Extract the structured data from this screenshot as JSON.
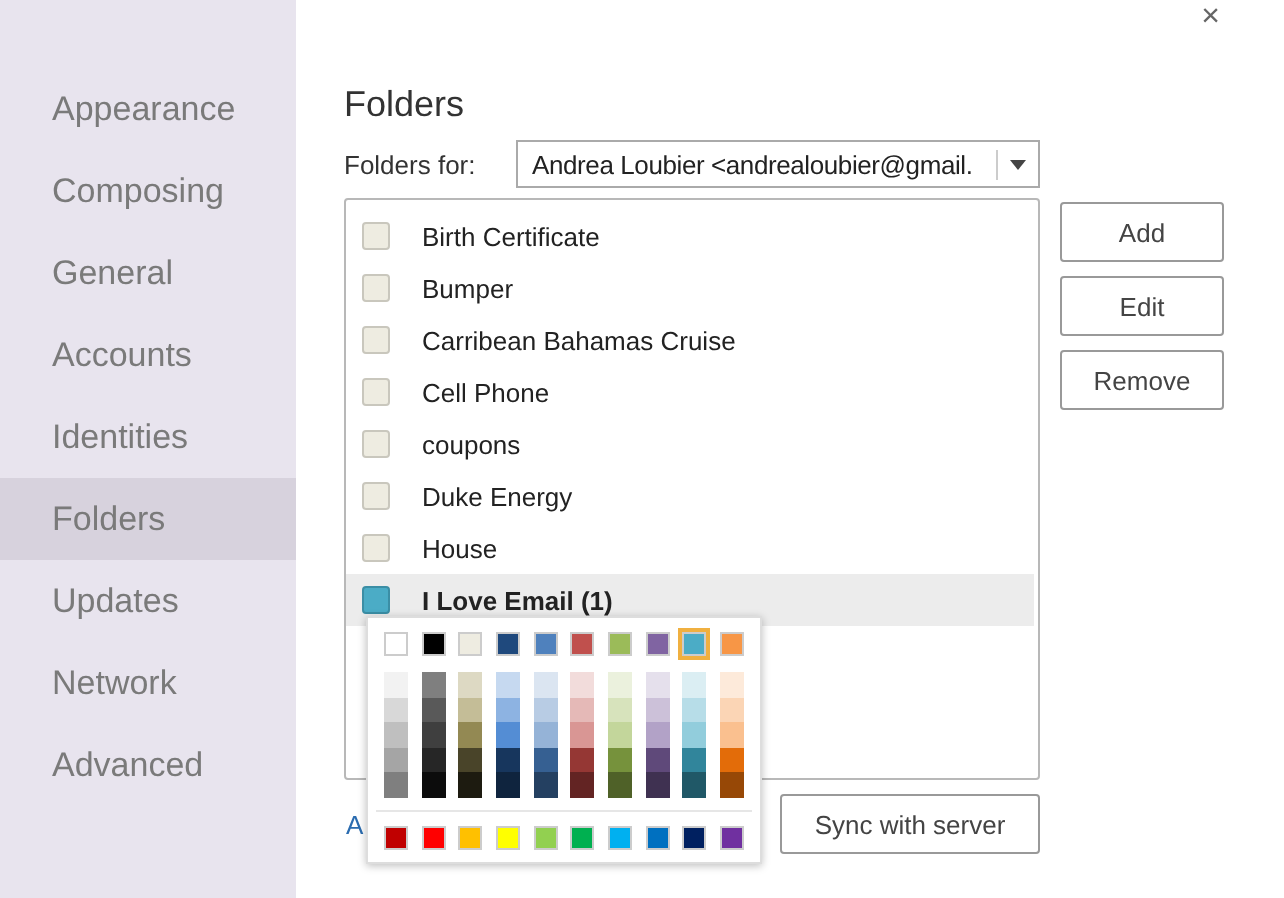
{
  "close": "×",
  "sidebar": {
    "items": [
      {
        "label": "Appearance",
        "selected": false
      },
      {
        "label": "Composing",
        "selected": false
      },
      {
        "label": "General",
        "selected": false
      },
      {
        "label": "Accounts",
        "selected": false
      },
      {
        "label": "Identities",
        "selected": false
      },
      {
        "label": "Folders",
        "selected": true
      },
      {
        "label": "Updates",
        "selected": false
      },
      {
        "label": "Network",
        "selected": false
      },
      {
        "label": "Advanced",
        "selected": false
      }
    ]
  },
  "title": "Folders",
  "folders_for": {
    "label": "Folders for:",
    "value": "Andrea Loubier  <andrealoubier@gmail."
  },
  "folders": [
    {
      "label": "Birth Certificate",
      "color": "#eeece1",
      "selected": false
    },
    {
      "label": "Bumper",
      "color": "#eeece1",
      "selected": false
    },
    {
      "label": "Carribean Bahamas Cruise",
      "color": "#eeece1",
      "selected": false
    },
    {
      "label": "Cell Phone",
      "color": "#eeece1",
      "selected": false
    },
    {
      "label": "coupons",
      "color": "#eeece1",
      "selected": false
    },
    {
      "label": "Duke Energy",
      "color": "#eeece1",
      "selected": false
    },
    {
      "label": "House",
      "color": "#eeece1",
      "selected": false
    },
    {
      "label": "I Love Email (1)",
      "color": "#4bacc6",
      "selected": true
    }
  ],
  "buttons": [
    "Add",
    "Edit",
    "Remove"
  ],
  "link": "A",
  "sync_button": "Sync with server",
  "palette": {
    "theme": [
      {
        "color": "#ffffff",
        "selected": false
      },
      {
        "color": "#000000",
        "selected": false
      },
      {
        "color": "#eeece1",
        "selected": false
      },
      {
        "color": "#1f497d",
        "selected": false
      },
      {
        "color": "#4f81bd",
        "selected": false
      },
      {
        "color": "#c0504d",
        "selected": false
      },
      {
        "color": "#9bbb59",
        "selected": false
      },
      {
        "color": "#8064a2",
        "selected": false
      },
      {
        "color": "#4bacc6",
        "selected": true
      },
      {
        "color": "#f79646",
        "selected": false
      }
    ],
    "shades": [
      {
        "swatches": [
          {
            "color": "#f2f2f2"
          },
          {
            "color": "#d8d8d8"
          },
          {
            "color": "#bfbfbf"
          },
          {
            "color": "#a5a5a5"
          },
          {
            "color": "#7f7f7f"
          }
        ]
      },
      {
        "swatches": [
          {
            "color": "#7f7f7f"
          },
          {
            "color": "#595959"
          },
          {
            "color": "#3f3f3f"
          },
          {
            "color": "#262626"
          },
          {
            "color": "#0c0c0c"
          }
        ]
      },
      {
        "swatches": [
          {
            "color": "#ddd9c3"
          },
          {
            "color": "#c4bd97"
          },
          {
            "color": "#938953"
          },
          {
            "color": "#494429"
          },
          {
            "color": "#1d1b10"
          }
        ]
      },
      {
        "swatches": [
          {
            "color": "#c6d9f0"
          },
          {
            "color": "#8db3e2"
          },
          {
            "color": "#548dd4"
          },
          {
            "color": "#17365d"
          },
          {
            "color": "#0f243e"
          }
        ]
      },
      {
        "swatches": [
          {
            "color": "#dbe5f1"
          },
          {
            "color": "#b8cce4"
          },
          {
            "color": "#95b3d7"
          },
          {
            "color": "#366092"
          },
          {
            "color": "#244061"
          }
        ]
      },
      {
        "swatches": [
          {
            "color": "#f2dcdb"
          },
          {
            "color": "#e5b9b7"
          },
          {
            "color": "#d99694"
          },
          {
            "color": "#953734"
          },
          {
            "color": "#632423"
          }
        ]
      },
      {
        "swatches": [
          {
            "color": "#ebf1dd"
          },
          {
            "color": "#d7e3bc"
          },
          {
            "color": "#c3d69b"
          },
          {
            "color": "#76923c"
          },
          {
            "color": "#4f6128"
          }
        ]
      },
      {
        "swatches": [
          {
            "color": "#e5e0ec"
          },
          {
            "color": "#ccc1d9"
          },
          {
            "color": "#b2a2c7"
          },
          {
            "color": "#5f497a"
          },
          {
            "color": "#3f3151"
          }
        ]
      },
      {
        "swatches": [
          {
            "color": "#dbeef3"
          },
          {
            "color": "#b7dde8"
          },
          {
            "color": "#92cddc"
          },
          {
            "color": "#31859b"
          },
          {
            "color": "#205867"
          }
        ]
      },
      {
        "swatches": [
          {
            "color": "#fdeada"
          },
          {
            "color": "#fbd5b5"
          },
          {
            "color": "#fac08f"
          },
          {
            "color": "#e36c09"
          },
          {
            "color": "#974806"
          }
        ]
      }
    ],
    "standard": [
      {
        "color": "#c00000"
      },
      {
        "color": "#ff0000"
      },
      {
        "color": "#ffc000"
      },
      {
        "color": "#ffff00"
      },
      {
        "color": "#92d050"
      },
      {
        "color": "#00b050"
      },
      {
        "color": "#00b0f0"
      },
      {
        "color": "#0070c0"
      },
      {
        "color": "#002060"
      },
      {
        "color": "#7030a0"
      }
    ]
  }
}
